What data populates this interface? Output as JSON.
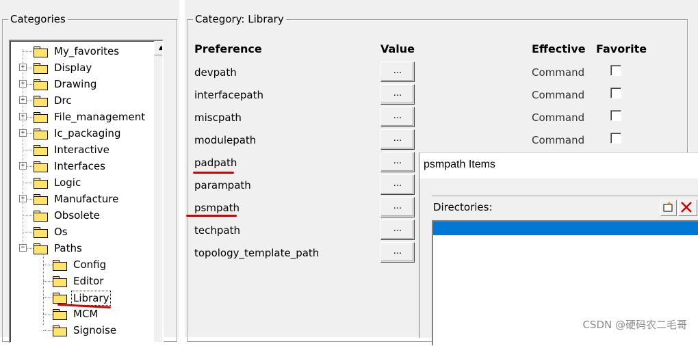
{
  "categories_panel": {
    "title": "Categories",
    "tree": [
      {
        "label": "My_favorites",
        "level": 0,
        "expander": ""
      },
      {
        "label": "Display",
        "level": 0,
        "expander": "+"
      },
      {
        "label": "Drawing",
        "level": 0,
        "expander": "+"
      },
      {
        "label": "Drc",
        "level": 0,
        "expander": "+"
      },
      {
        "label": "File_management",
        "level": 0,
        "expander": "+"
      },
      {
        "label": "Ic_packaging",
        "level": 0,
        "expander": "+"
      },
      {
        "label": "Interactive",
        "level": 0,
        "expander": ""
      },
      {
        "label": "Interfaces",
        "level": 0,
        "expander": "+"
      },
      {
        "label": "Logic",
        "level": 0,
        "expander": ""
      },
      {
        "label": "Manufacture",
        "level": 0,
        "expander": "+"
      },
      {
        "label": "Obsolete",
        "level": 0,
        "expander": ""
      },
      {
        "label": "Os",
        "level": 0,
        "expander": ""
      },
      {
        "label": "Paths",
        "level": 0,
        "expander": "-"
      },
      {
        "label": "Config",
        "level": 1,
        "expander": ""
      },
      {
        "label": "Editor",
        "level": 1,
        "expander": ""
      },
      {
        "label": "Library",
        "level": 1,
        "expander": ""
      },
      {
        "label": "MCM",
        "level": 1,
        "expander": ""
      },
      {
        "label": "Signoise",
        "level": 1,
        "expander": ""
      }
    ]
  },
  "category_panel": {
    "title": "Category:  Library",
    "headers": {
      "preference": "Preference",
      "value": "Value",
      "effective": "Effective",
      "favorite": "Favorite"
    },
    "rows": [
      {
        "preference": "devpath",
        "button": "...",
        "effective": "Command"
      },
      {
        "preference": "interfacepath",
        "button": "...",
        "effective": "Command"
      },
      {
        "preference": "miscpath",
        "button": "...",
        "effective": "Command"
      },
      {
        "preference": "modulepath",
        "button": "...",
        "effective": "Command"
      },
      {
        "preference": "padpath",
        "button": "...",
        "effective": ""
      },
      {
        "preference": "parampath",
        "button": "...",
        "effective": ""
      },
      {
        "preference": "psmpath",
        "button": "...",
        "effective": ""
      },
      {
        "preference": "techpath",
        "button": "...",
        "effective": ""
      },
      {
        "preference": "topology_template_path",
        "button": "...",
        "effective": ""
      }
    ]
  },
  "dialog": {
    "title": "psmpath Items",
    "directories_label": "Directories:"
  },
  "watermark": "CSDN @硬码农二毛哥",
  "colors": {
    "selection": "#0078d7",
    "annotation_underline": "#d40000",
    "folder": "#ffe36b"
  }
}
